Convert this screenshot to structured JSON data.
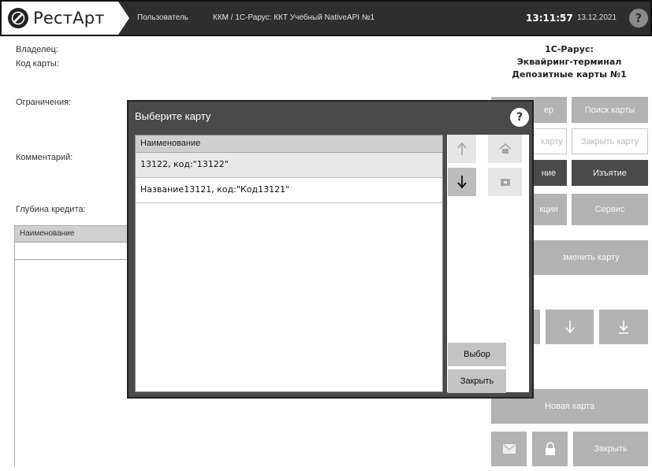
{
  "topbar": {
    "brand": "РестАрт",
    "user_label": "Пользователь",
    "kkm_label": "ККМ / 1С-Рарус: ККТ Учебный NativeAPI №1",
    "time": "13:11:57",
    "date": "13.12.2021",
    "help_glyph": "?"
  },
  "card_info": {
    "owner_label": "Владелец:",
    "card_code_label": "Код карты:",
    "restrictions_label": "Ограничения:",
    "comment_label": "Комментарий:",
    "credit_depth_label": "Глубина кредита:",
    "table_header": "Наименование"
  },
  "right_panel": {
    "title_line1": "1С-Рарус:",
    "title_line2": "Эквайринг-терминал",
    "title_line3": "Депозитные карты №1",
    "buttons": {
      "filter_partial": "ер",
      "search_card": "Поиск карты",
      "card_partial": "карту",
      "close_card": "Закрыть карту",
      "partial_nie": "ние",
      "withdraw": "Изъятие",
      "partial_ktsii": "кции",
      "service": "Сервис",
      "change_card_partial": "зменить карту",
      "new_card": "Новая карта",
      "close": "Закрыть"
    }
  },
  "dialog": {
    "title": "Выберите карту",
    "help_glyph": "?",
    "list_header": "Наименование",
    "rows": [
      {
        "text": "13122, код:\"13122\""
      },
      {
        "text": "Название13121, код:\"Код13121\""
      }
    ],
    "select_button": "Выбор",
    "close_button": "Закрыть"
  },
  "colors": {
    "topbar_bg": "#2e2e2e",
    "dialog_bg": "#4a4a4a",
    "dark_button": "#4a4a4a",
    "mid_button": "#bfbfbf"
  },
  "icons": [
    "logo-icon",
    "help-icon",
    "arrow-up-icon",
    "arrow-down-icon",
    "home-icon",
    "folder-icon",
    "envelope-icon",
    "lock-icon",
    "arrow-down-to-line-icon"
  ]
}
